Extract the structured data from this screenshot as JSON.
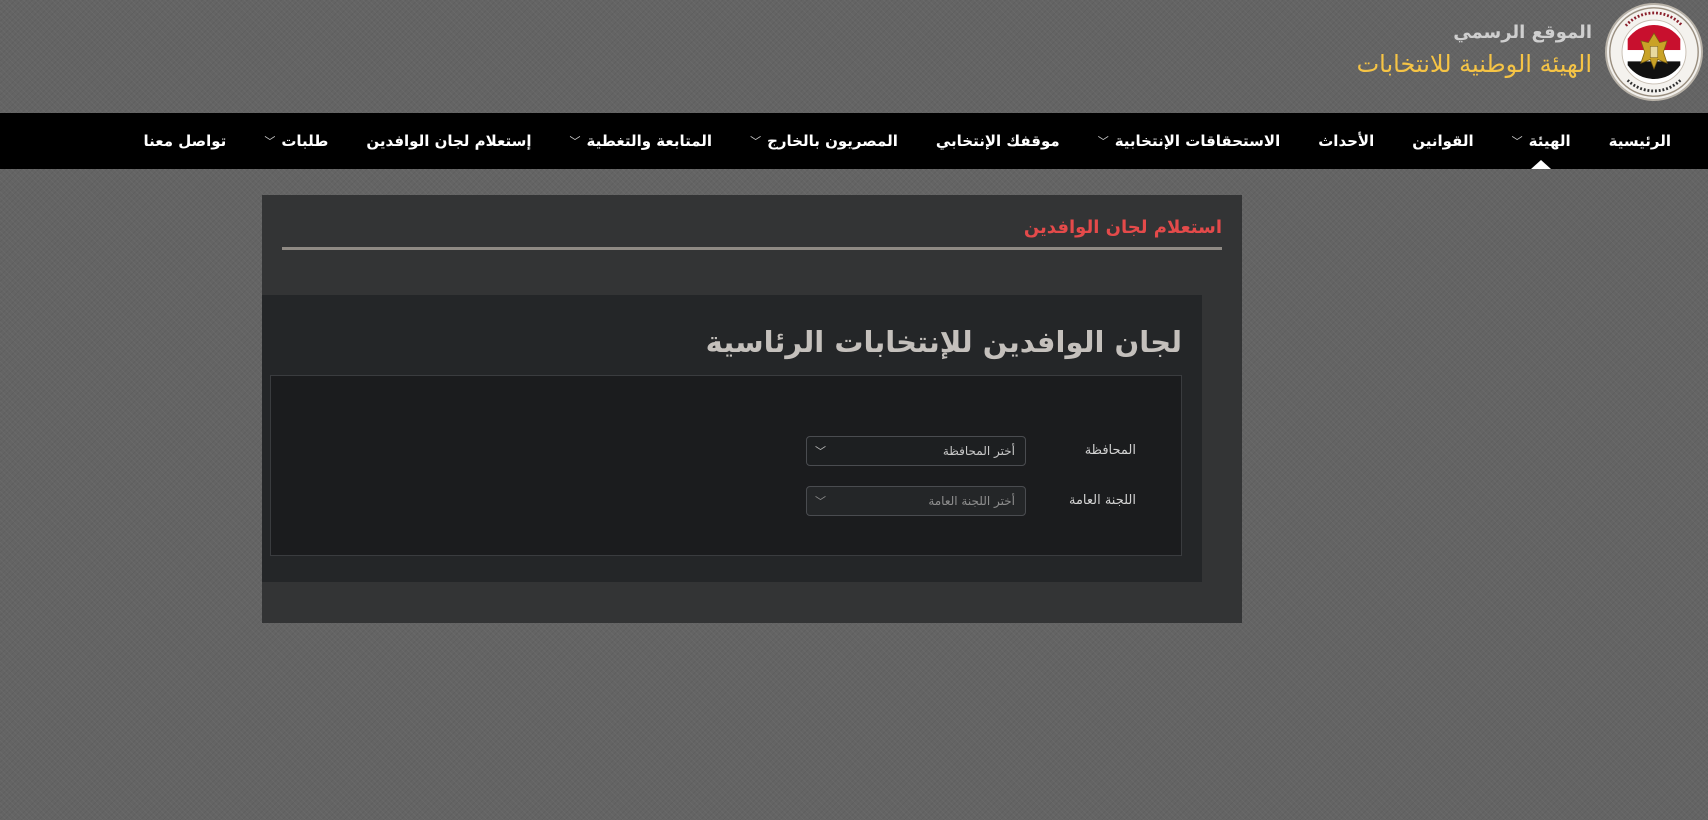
{
  "header": {
    "subtitle": "الموقع الرسمي",
    "title": "الهيئة الوطنية للانتخابات",
    "logo_icon": "eagle-seal-icon"
  },
  "nav": {
    "items": [
      {
        "label": "الرئيسية",
        "dropdown": false,
        "active": false
      },
      {
        "label": "الهيئة",
        "dropdown": true,
        "active": true
      },
      {
        "label": "القوانين",
        "dropdown": false,
        "active": false
      },
      {
        "label": "الأحداث",
        "dropdown": false,
        "active": false
      },
      {
        "label": "الاستحقاقات الإنتخابية",
        "dropdown": true,
        "active": false
      },
      {
        "label": "موقفك الإنتخابي",
        "dropdown": false,
        "active": false
      },
      {
        "label": "المصريون بالخارج",
        "dropdown": true,
        "active": false
      },
      {
        "label": "المتابعة والتغطية",
        "dropdown": true,
        "active": false
      },
      {
        "label": "إستعلام لجان الوافدين",
        "dropdown": false,
        "active": false
      },
      {
        "label": "طلبات",
        "dropdown": true,
        "active": false
      },
      {
        "label": "تواصل معنا",
        "dropdown": false,
        "active": false
      }
    ],
    "chevron_glyph": "﹀"
  },
  "panel": {
    "heading": "استعلام لجان الوافدين",
    "title": "لجان الوافدين للإنتخابات الرئاسية"
  },
  "form": {
    "governorate": {
      "label": "المحافظة",
      "value": "أختر المحافظة"
    },
    "committee": {
      "label": "اللجنة العامة",
      "value": "أختر اللجنة العامة"
    },
    "arrow_glyph": "﹀"
  },
  "colors": {
    "accent_red": "#e44a4a",
    "accent_gold": "#f6c445",
    "navbar": "#000000"
  }
}
